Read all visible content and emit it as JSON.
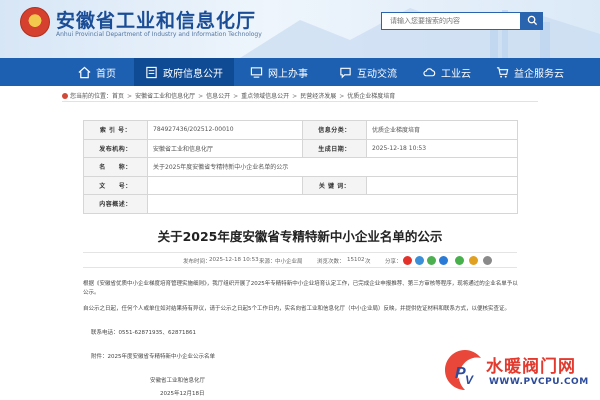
{
  "header": {
    "title": "安徽省工业和信息化厅",
    "subtitle": "Anhui Provincial Department of Industry and Information Technology",
    "search_placeholder": "请输入您要搜索的内容"
  },
  "nav": {
    "items": [
      {
        "label": "首页",
        "icon": "home-icon"
      },
      {
        "label": "政府信息公开",
        "icon": "gov-info-icon",
        "active": true
      },
      {
        "label": "网上办事",
        "icon": "monitor-icon"
      },
      {
        "label": "互动交流",
        "icon": "chat-icon"
      },
      {
        "label": "工业云",
        "icon": "cloud-icon"
      },
      {
        "label": "益企服务云",
        "icon": "cart-icon"
      }
    ]
  },
  "breadcrumb": {
    "prefix": "您当前的位置：",
    "items": [
      "首页",
      "安徽省工业和信息化厅",
      "信息公开",
      "重点领域信息公开",
      "民营经济发展",
      "优质企业梯度培育"
    ]
  },
  "info": {
    "index_label": "索 引 号：",
    "index_value": "784927436/202512-00010",
    "category_label": "信息分类：",
    "category_value": "优质企业梯度培育",
    "org_label": "发布机构：",
    "org_value": "安徽省工业和信息化厅",
    "date_label": "生成日期：",
    "date_value": "2025-12-18 10:53",
    "name_label": "名　　称：",
    "name_value": "关于2025年度安徽省专精特新中小企业名单的公示",
    "docno_label": "文　　号：",
    "docno_value": "",
    "keywords_label": "关 键 词：",
    "keywords_value": "",
    "content_label": "内容概述：",
    "content_value": ""
  },
  "article": {
    "title": "关于2025年度安徽省专精特新中小企业名单的公示",
    "meta_date_label": "发布时间：",
    "meta_date": "2025-12-18 10:53",
    "meta_source_label": "来源：",
    "meta_source": "中小企业局",
    "meta_views_label": "浏览次数：",
    "meta_views": "15102",
    "meta_views_unit": "次",
    "share_label": "分享：",
    "para1": "根据《安徽省优质中小企业梯度培育管理实施细则》，我厅组织开展了2025年专精特新中小企业培育认定工作，已完成企业申报推荐、第三方审核等程序，现将通过的企业名单予以公示。",
    "para2": "自公示之日起，任何个人或单位如对结果持有异议，请于公示之日起5个工作日内，实名向省工业和信息化厅（中小企业局）反映，并提供佐证材料和联系方式，以便核实查证。",
    "phone": "联系电话：0551-62871935、62871861",
    "attachment": "附件：2025年度安徽省专精特新中小企业公示名单",
    "signature": "安徽省工业和信息化厅",
    "sign_date": "2025年12月18日"
  },
  "watermark": {
    "text": "水暖阀门网",
    "url": "WWW.PVCPU.COM"
  },
  "colors": {
    "nav_bg": "#1d5fb0",
    "nav_active": "#0f4a94",
    "title_blue": "#1a4d96",
    "watermark_red": "#e23a2e"
  }
}
